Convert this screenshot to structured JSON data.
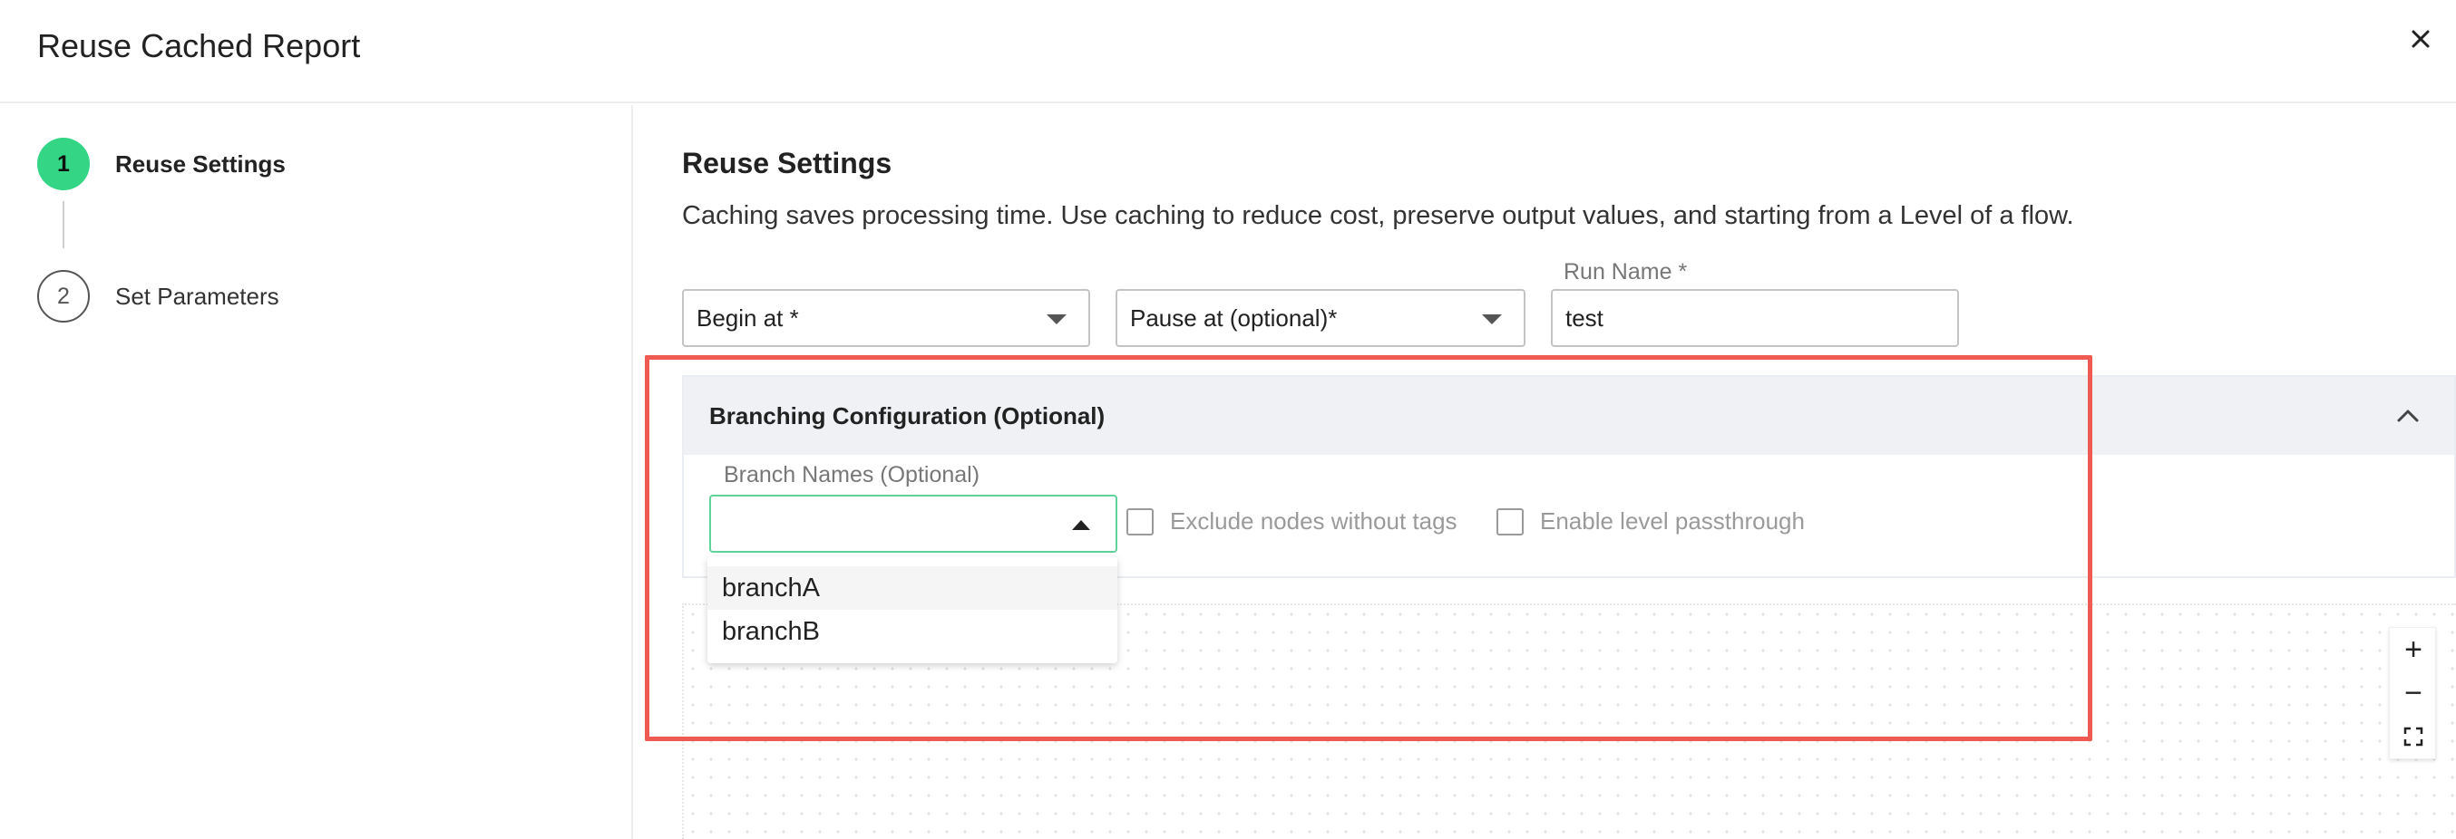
{
  "header": {
    "title": "Reuse Cached Report",
    "close_label": "×"
  },
  "steps": [
    {
      "number": "1",
      "label": "Reuse Settings",
      "active": true
    },
    {
      "number": "2",
      "label": "Set Parameters",
      "active": false
    }
  ],
  "main": {
    "section_title": "Reuse Settings",
    "description": "Caching saves processing time. Use caching to reduce cost, preserve output values, and starting from a Level of a flow.",
    "begin_at": {
      "value": "Begin at *"
    },
    "pause_at": {
      "value": "Pause at (optional)*"
    },
    "run_name": {
      "label": "Run Name *",
      "value": "test"
    }
  },
  "branching": {
    "title": "Branching Configuration (Optional)",
    "branch_names_label": "Branch Names (Optional)",
    "options": [
      "branchA",
      "branchB"
    ],
    "exclude_label": "Exclude nodes without tags",
    "passthrough_label": "Enable level passthrough"
  },
  "zoom": {
    "in": "+",
    "out": "−"
  },
  "colors": {
    "accent": "#34d585",
    "focus_border": "#5fd39a",
    "highlight": "#ef5a52"
  }
}
